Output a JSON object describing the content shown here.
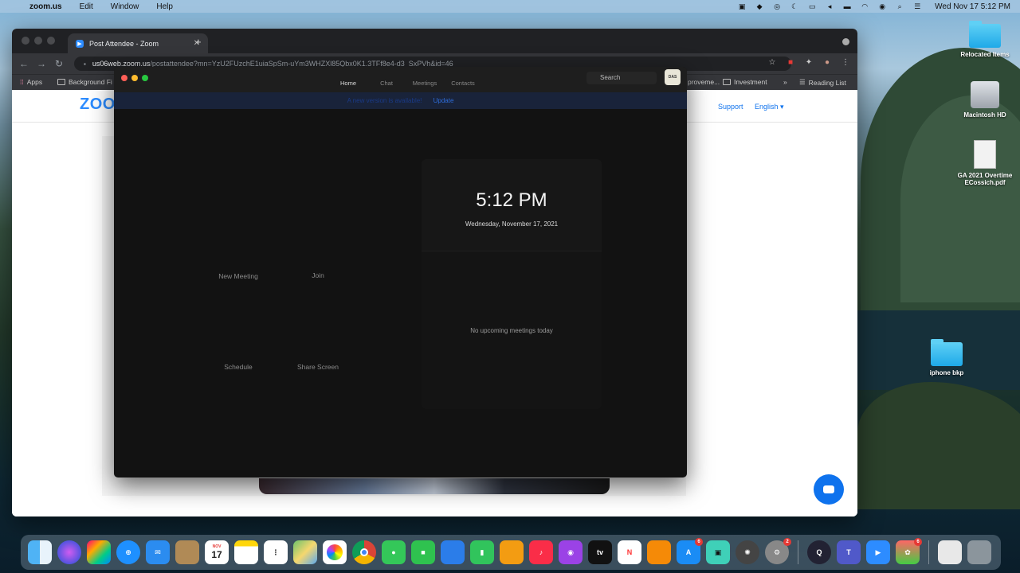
{
  "menubar": {
    "app_name": "zoom.us",
    "items": [
      "Edit",
      "Window",
      "Help"
    ],
    "clock": "Wed Nov 17  5:12 PM"
  },
  "browser": {
    "tab_title": "Post Attendee - Zoom",
    "url_host": "us06web.zoom.us",
    "url_path": "/postattendee?mn=YzU2FUzchE1uiaSpSm-uYm3WHZXl85Qbx0K1.3TFf8e4-d3_SxPVh&id=46",
    "bookmarks": {
      "apps": "Apps",
      "background": "Background Fi",
      "improve": "proveme...",
      "investment": "Investment",
      "more": "»",
      "reading_list": "Reading List"
    },
    "page": {
      "logo": "ZOO",
      "support": "Support",
      "language": "English ▾"
    }
  },
  "zoom_app": {
    "tabs": [
      "Home",
      "Chat",
      "Meetings",
      "Contacts"
    ],
    "active_tab": "Home",
    "search_placeholder": "Search",
    "avatar_text": "DAS",
    "banner": {
      "message": "A new version is available!",
      "action": "Update"
    },
    "actions": {
      "new_meeting": "New Meeting",
      "join": "Join",
      "schedule": "Schedule",
      "share_screen": "Share Screen"
    },
    "time": "5:12 PM",
    "date": "Wednesday, November 17, 2021",
    "no_meetings": "No upcoming meetings today",
    "colors": {
      "close": "#ff5f57",
      "minimize": "#febc2e",
      "zoom": "#28c840",
      "accent": "#2d8cff"
    }
  },
  "desktop": {
    "icons": [
      {
        "label": "Relocated Items",
        "type": "folder-icon"
      },
      {
        "label": "Macintosh HD",
        "type": "hard-disk-icon"
      },
      {
        "label": "GA 2021 Overtime ECossich.pdf",
        "type": "pdf-file-icon"
      },
      {
        "label": "iphone bkp",
        "type": "folder-icon"
      }
    ]
  },
  "dock": {
    "calendar_month": "NOV",
    "calendar_day": "17",
    "badges": {
      "app_store": "6",
      "settings": "2",
      "messages": "6"
    },
    "apps": [
      "finder",
      "siri",
      "launchpad",
      "safari",
      "mail",
      "contacts",
      "calendar",
      "notes",
      "reminders",
      "maps",
      "photos",
      "chrome",
      "messages",
      "facetime",
      "keynote",
      "numbers",
      "pages",
      "music",
      "podcasts",
      "tv",
      "news",
      "books",
      "app-store",
      "classroom",
      "davinci",
      "system-preferences",
      "quicktime",
      "teams",
      "zoom",
      "pdf-app",
      "downloads",
      "trash"
    ]
  }
}
